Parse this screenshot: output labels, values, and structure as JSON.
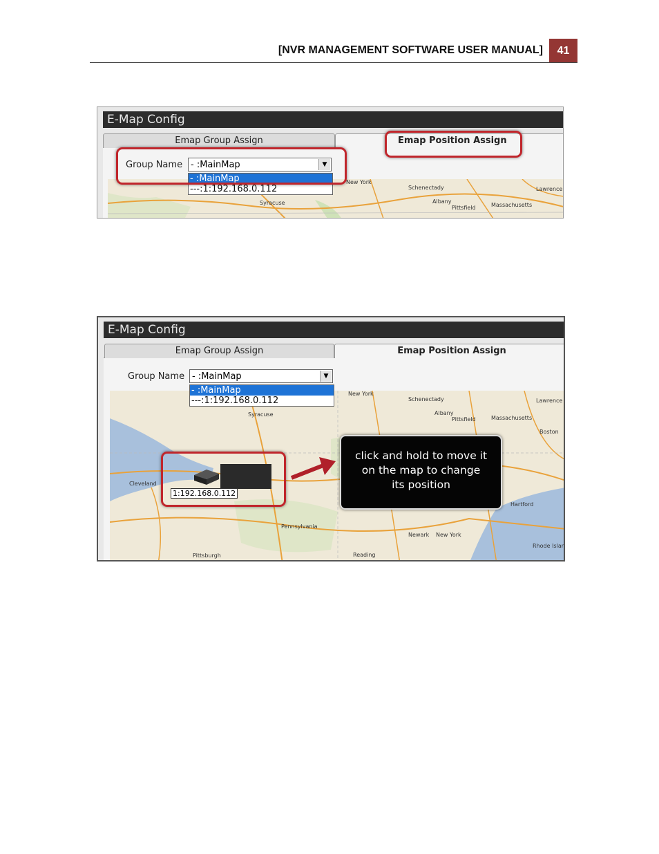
{
  "header": {
    "title": "[NVR MANAGEMENT SOFTWARE USER MANUAL]",
    "page_number": "41"
  },
  "screenshot1": {
    "window_title": "E-Map Config",
    "tabs": [
      "Emap Group Assign",
      "Emap Position Assign"
    ],
    "group_name_label": "Group Name",
    "group_select_value": "- :MainMap",
    "dropdown_options": [
      "- :MainMap",
      "---:1:192.168.0.112"
    ],
    "map_labels": [
      "New York",
      "Schenectady",
      "Massachusetts",
      "Lawrence",
      "Albany",
      "Pittsfield",
      "Syracuse"
    ]
  },
  "screenshot2": {
    "window_title": "E-Map Config",
    "tabs": [
      "Emap Group Assign",
      "Emap Position Assign"
    ],
    "group_name_label": "Group Name",
    "group_select_value": "- :MainMap",
    "dropdown_options": [
      "- :MainMap",
      "---:1:192.168.0.112"
    ],
    "device_label": "1:192.168.0.112",
    "tooltip_lines": [
      "click and hold to move it",
      "on the map to change",
      "its position"
    ],
    "map_labels": [
      "New York",
      "Schenectady",
      "Massachusetts",
      "Lawrence",
      "Albany",
      "Pittsfield",
      "Syracuse",
      "Cleveland",
      "Pennsylvania",
      "Newark",
      "New York",
      "Rhode Island",
      "Reading",
      "Pittsburgh",
      "Hartford",
      "Boston"
    ]
  },
  "colors": {
    "header_accent": "#943634",
    "callout_red": "#c0262c",
    "dropdown_selected": "#1e73d6",
    "titlebar": "#2c2c2c"
  }
}
